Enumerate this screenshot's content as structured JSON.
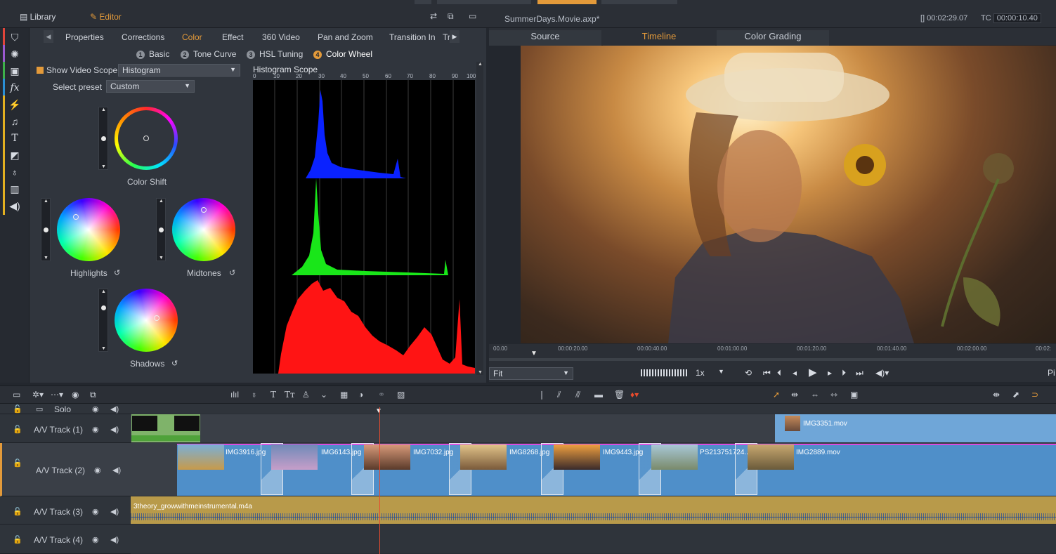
{
  "top": {
    "library_tab": "Library",
    "editor_tab": "Editor",
    "project_title": "SummerDays.Movie.axp*",
    "duration": "[] 00:02:29.07",
    "tc_label": "TC",
    "timecode": "00:00:10.40"
  },
  "editor": {
    "subtabs": [
      "Properties",
      "Corrections",
      "Color",
      "Effect",
      "360 Video",
      "Pan and Zoom",
      "Transition In",
      "Tr"
    ],
    "color_tabs": [
      {
        "num": "1",
        "label": "Basic"
      },
      {
        "num": "2",
        "label": "Tone Curve"
      },
      {
        "num": "3",
        "label": "HSL Tuning"
      },
      {
        "num": "4",
        "label": "Color Wheel"
      }
    ],
    "show_scope_label": "Show Video Scope",
    "scope_type": "Histogram",
    "preset_label": "Select preset",
    "preset_value": "Custom",
    "wheels": {
      "color_shift": "Color Shift",
      "highlights": "Highlights",
      "midtones": "Midtones",
      "shadows": "Shadows"
    }
  },
  "scope": {
    "title": "Histogram Scope",
    "ticks": [
      "0",
      "10",
      "20",
      "30",
      "40",
      "50",
      "60",
      "70",
      "80",
      "90",
      "100"
    ]
  },
  "viewer": {
    "tabs": [
      "Source",
      "Timeline",
      "Color Grading"
    ],
    "active_tab": "Timeline",
    "ruler": [
      "00.00",
      "00:00:20.00",
      "00:00:40.00",
      "00:01:00.00",
      "00:01:20.00",
      "00:01:40.00",
      "00:02:00.00",
      "00:02:"
    ],
    "fit": "Fit",
    "speed": "1x",
    "pi": "Pi"
  },
  "timeline": {
    "tracks": [
      {
        "name": "Solo"
      },
      {
        "name": "A/V Track (1)"
      },
      {
        "name": "A/V Track (2)"
      },
      {
        "name": "A/V Track (3)"
      },
      {
        "name": "A/V Track (4)"
      }
    ],
    "clips_track1": [
      "IMG3351.mov"
    ],
    "clips_track2": [
      "IMG3916.jpg",
      "IMG6143.jpg",
      "IMG7032.jpg",
      "IMG8268.jpg",
      "IMG9443.jpg",
      "PS213751724...",
      "IMG2889.mov"
    ],
    "audio_clip": "3theory_growwithmeinstrumental.m4a"
  },
  "colors": {
    "accent": "#e39a3a",
    "clip_blue": "#4f8fc9",
    "audio_gold": "#b89a4a",
    "playhead": "#e84b2e"
  }
}
